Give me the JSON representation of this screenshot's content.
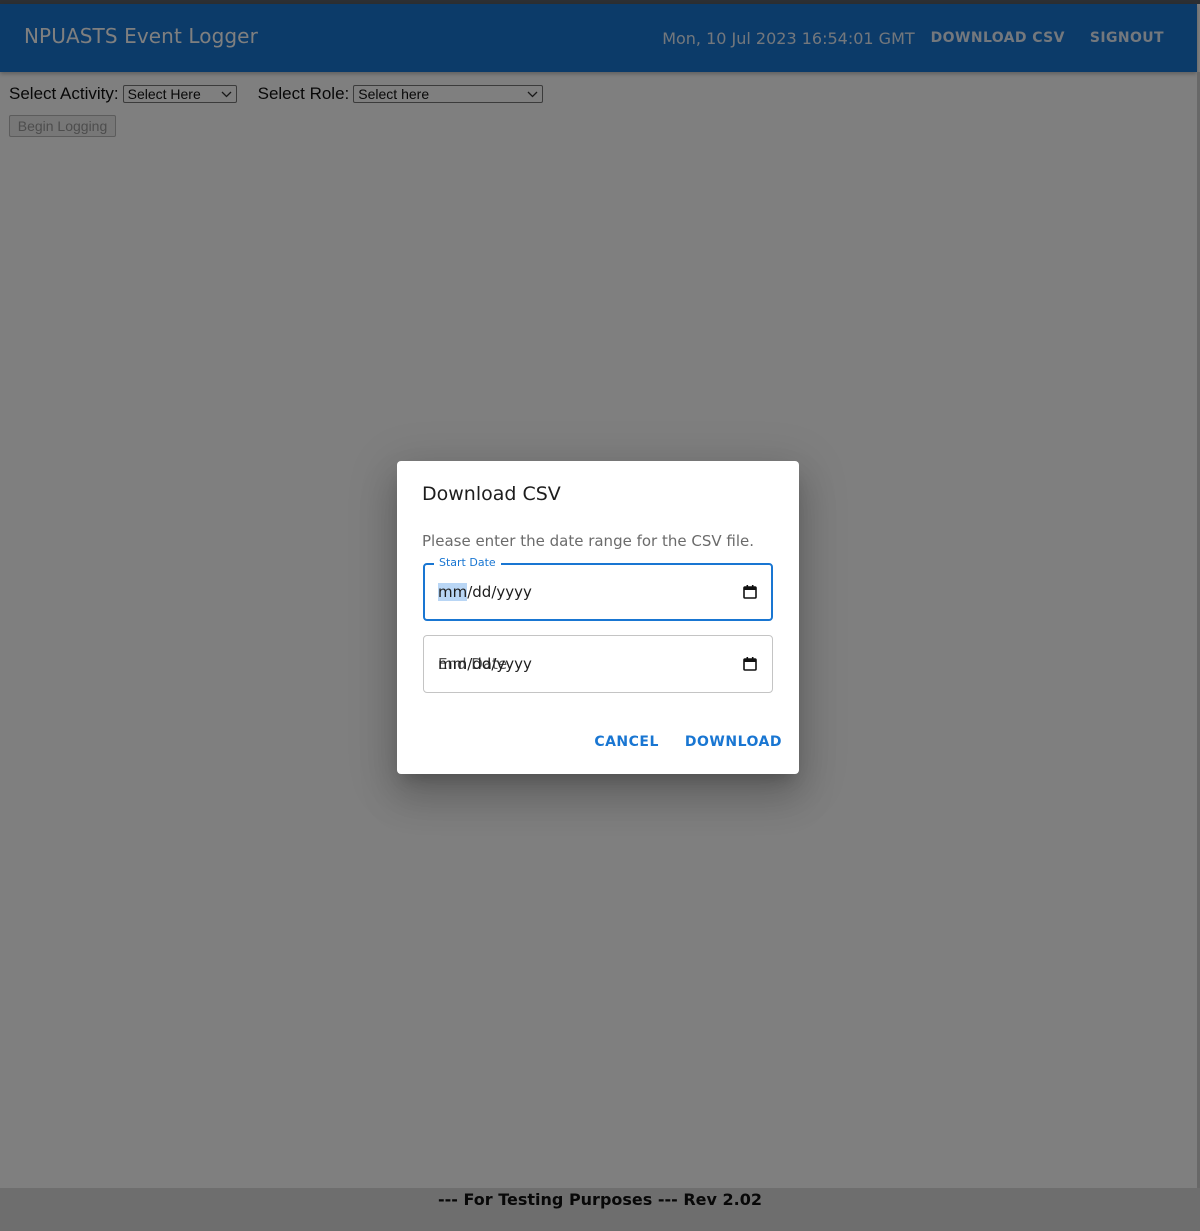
{
  "appbar": {
    "title": "NPUASTS Event Logger",
    "clock": "Mon, 10 Jul 2023 16:54:01 GMT",
    "download_csv_label": "DOWNLOAD CSV",
    "signout_label": "SIGNOUT",
    "color": "#1976d2"
  },
  "controls": {
    "activity_label": "Select Activity:",
    "activity_value": "Select Here",
    "role_label": "Select Role:",
    "role_value": "Select here",
    "begin_label": "Begin Logging"
  },
  "dialog": {
    "title": "Download CSV",
    "text": "Please enter the date range for the CSV file.",
    "start_date": {
      "label": "Start Date",
      "segment_month": "mm",
      "segment_rest": "/dd/yyyy"
    },
    "end_date": {
      "label": "End Date",
      "placeholder": "mm/dd/yyyy"
    },
    "cancel_label": "CANCEL",
    "download_label": "DOWNLOAD"
  },
  "footer": {
    "text": "--- For Testing Purposes --- Rev 2.02"
  },
  "icons": {
    "calendar": "calendar-icon",
    "dropdown": "chevron-down-icon"
  }
}
